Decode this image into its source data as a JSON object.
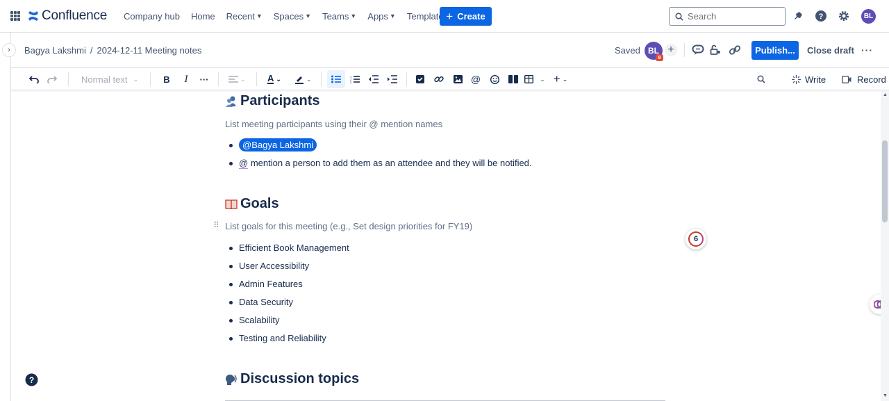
{
  "nav": {
    "logo_text": "Confluence",
    "items": [
      {
        "label": "Company hub",
        "chevron": false
      },
      {
        "label": "Home",
        "chevron": false
      },
      {
        "label": "Recent",
        "chevron": true
      },
      {
        "label": "Spaces",
        "chevron": true
      },
      {
        "label": "Teams",
        "chevron": true
      },
      {
        "label": "Apps",
        "chevron": true
      },
      {
        "label": "Templates",
        "chevron": false
      }
    ],
    "create_label": "Create",
    "search_placeholder": "Search",
    "avatar_initials": "BL"
  },
  "header": {
    "breadcrumb": [
      "Bagya Lakshmi",
      "/",
      "2024-12-11 Meeting notes"
    ],
    "saved_label": "Saved",
    "avatar_initials": "BL",
    "avatar_badge": "8",
    "publish_label": "Publish...",
    "close_draft_label": "Close draft"
  },
  "toolbar": {
    "text_style": "Normal text",
    "write_label": "Write",
    "record_label": "Record"
  },
  "content": {
    "participants": {
      "title": "Participants",
      "placeholder": "List meeting participants using their @ mention names",
      "mention": "@Bagya Lakshmi",
      "hint_at": "@",
      "hint_text": " mention a person to add them as an attendee and they will be notified."
    },
    "goals": {
      "title": "Goals",
      "placeholder": "List goals for this meeting (e.g., Set design priorities for FY19)",
      "items": [
        "Efficient Book Management",
        "User Accessibility",
        "Admin Features",
        "Data Security",
        "Scalability",
        "Testing and Reliability"
      ]
    },
    "discussion": {
      "title": "Discussion topics"
    },
    "comment_count": "6"
  },
  "colors": {
    "brand_blue": "#0c66e4",
    "avatar_purple": "#5e4db2",
    "text_dark": "#172b4d",
    "text_muted": "#626f86"
  }
}
